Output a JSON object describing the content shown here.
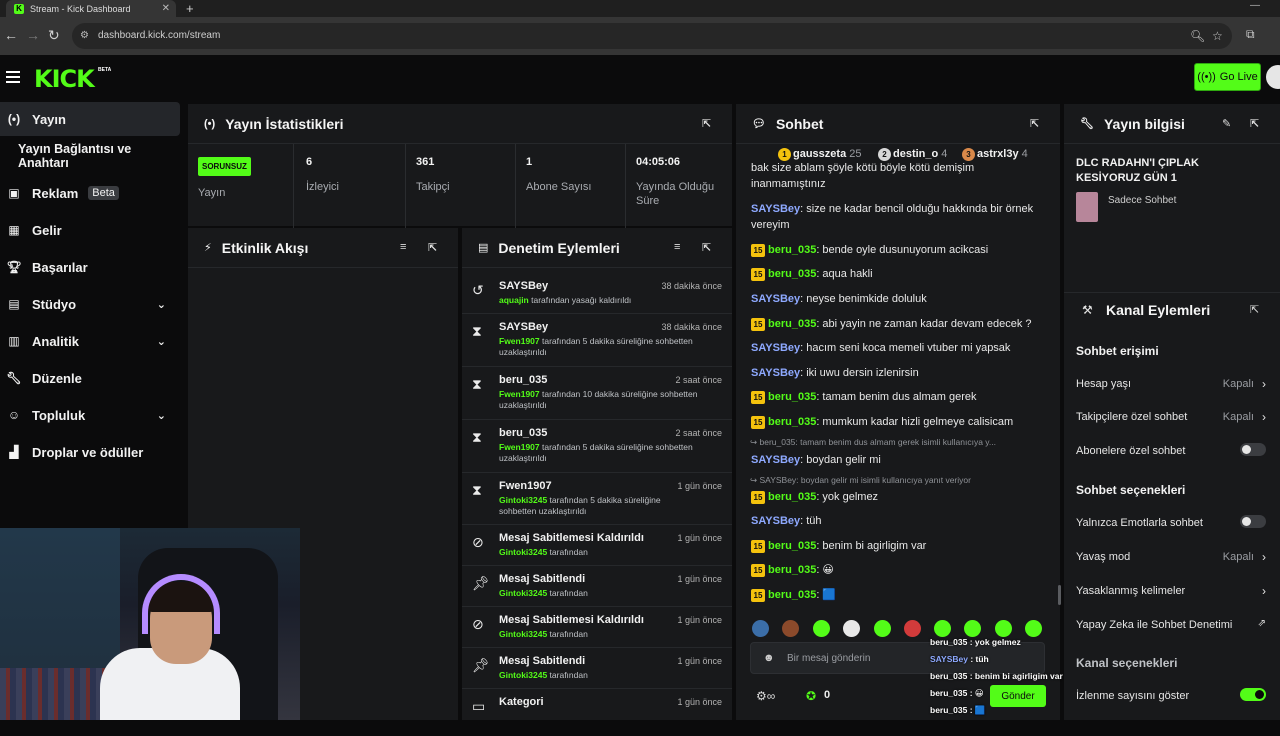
{
  "browser": {
    "tab_title": "Stream - Kick Dashboard",
    "tab_close": "✕",
    "new_tab": "+",
    "url": "dashboard.kick.com/stream"
  },
  "header": {
    "logo": "KICK",
    "logo_badge": "BETA",
    "go_live": "Go Live"
  },
  "sidebar": {
    "items": [
      {
        "label": "Yayın",
        "icon": "broadcast-icon"
      },
      {
        "label": "Yayın Bağlantısı ve Anahtarı",
        "icon": ""
      },
      {
        "label": "Reklam",
        "icon": "ad-icon",
        "badge": "Beta"
      },
      {
        "label": "Gelir",
        "icon": "revenue-icon"
      },
      {
        "label": "Başarılar",
        "icon": "trophy-icon"
      },
      {
        "label": "Stüdyo",
        "icon": "studio-icon"
      },
      {
        "label": "Analitik",
        "icon": "analytics-icon"
      },
      {
        "label": "Düzenle",
        "icon": "wrench-icon"
      },
      {
        "label": "Topluluk",
        "icon": "community-icon"
      },
      {
        "label": "Droplar ve ödüller",
        "icon": "drops-icon"
      }
    ]
  },
  "stats": {
    "title": "Yayın İstatistikleri",
    "status_badge": "SORUNSUZ",
    "status_label": "Yayın",
    "items": [
      {
        "value": "6",
        "label": "İzleyici"
      },
      {
        "value": "361",
        "label": "Takipçi"
      },
      {
        "value": "1",
        "label": "Abone Sayısı"
      },
      {
        "value": "04:05:06",
        "label": "Yayında Olduğu Süre"
      }
    ]
  },
  "activity": {
    "title": "Etkinlik Akışı"
  },
  "moderation": {
    "title": "Denetim Eylemleri",
    "rows": [
      {
        "icon": "undo-icon",
        "title": "SAYSBey",
        "time": "38 dakika önce",
        "user": "aquajin",
        "text": " tarafından yasağı kaldırıldı"
      },
      {
        "icon": "hourglass-icon",
        "title": "SAYSBey",
        "time": "38 dakika önce",
        "user": "Fwen1907",
        "text": " tarafından 5 dakika süreliğine sohbetten uzaklaştırıldı"
      },
      {
        "icon": "hourglass-icon",
        "title": "beru_035",
        "time": "2 saat önce",
        "user": "Fwen1907",
        "text": " tarafından 10 dakika süreliğine sohbetten uzaklaştırıldı"
      },
      {
        "icon": "hourglass-icon",
        "title": "beru_035",
        "time": "2 saat önce",
        "user": "Fwen1907",
        "text": " tarafından 5 dakika süreliğine sohbetten uzaklaştırıldı"
      },
      {
        "icon": "hourglass-icon",
        "title": "Fwen1907",
        "time": "1 gün önce",
        "user": "Gintoki3245",
        "text": " tarafından 5 dakika süreliğine sohbetten uzaklaştırıldı"
      },
      {
        "icon": "unpin-icon",
        "title": "Mesaj Sabitlemesi Kaldırıldı",
        "time": "1 gün önce",
        "user": "Gintoki3245",
        "text": " tarafından"
      },
      {
        "icon": "pin-icon",
        "title": "Mesaj Sabitlendi",
        "time": "1 gün önce",
        "user": "Gintoki3245",
        "text": " tarafından"
      },
      {
        "icon": "unpin-icon",
        "title": "Mesaj Sabitlemesi Kaldırıldı",
        "time": "1 gün önce",
        "user": "Gintoki3245",
        "text": " tarafından"
      },
      {
        "icon": "pin-icon",
        "title": "Mesaj Sabitlendi",
        "time": "1 gün önce",
        "user": "Gintoki3245",
        "text": " tarafından"
      },
      {
        "icon": "category-icon",
        "title": "Kategori",
        "time": "1 gün önce",
        "user": "",
        "text": ""
      }
    ]
  },
  "chat": {
    "title": "Sohbet",
    "leaders": [
      {
        "rank": "1",
        "name": "gausszeta",
        "count": "25",
        "color": "#f4c20d"
      },
      {
        "rank": "2",
        "name": "destin_o",
        "count": "4",
        "color": "#d7d7d7"
      },
      {
        "rank": "3",
        "name": "astrxl3y",
        "count": "4",
        "color": "#d9894a"
      }
    ],
    "messages": [
      {
        "badge": false,
        "user": "",
        "ucolor": "b",
        "text": "bak size ablam şöyle kötü böyle kötü demişim inanmamıştınız",
        "partial": true
      },
      {
        "badge": false,
        "user": "SAYSBey",
        "ucolor": "b",
        "text": ": size ne kadar bencil olduğu hakkında bir örnek vereyim"
      },
      {
        "badge": true,
        "user": "beru_035",
        "ucolor": "g",
        "text": ": bende oyle dusunuyorum acikcasi"
      },
      {
        "badge": true,
        "user": "beru_035",
        "ucolor": "g",
        "text": ": aqua hakli"
      },
      {
        "badge": false,
        "user": "SAYSBey",
        "ucolor": "b",
        "text": ": neyse benimkide doluluk"
      },
      {
        "badge": true,
        "user": "beru_035",
        "ucolor": "g",
        "text": ": abi yayin ne zaman kadar devam edecek ?"
      },
      {
        "badge": false,
        "user": "SAYSBey",
        "ucolor": "b",
        "text": ": hacım seni koca memeli vtuber mi yapsak"
      },
      {
        "badge": false,
        "user": "SAYSBey",
        "ucolor": "b",
        "text": ": iki uwu dersin izlenirsin"
      },
      {
        "badge": true,
        "user": "beru_035",
        "ucolor": "g",
        "text": ": tamam benim dus almam gerek"
      },
      {
        "badge": true,
        "user": "beru_035",
        "ucolor": "g",
        "text": ": mumkum kadar hizli gelmeye calisicam"
      },
      {
        "reply": "↪ beru_035: tamam benim dus almam gerek isimli kullanıcıya y..."
      },
      {
        "badge": false,
        "user": "SAYSBey",
        "ucolor": "b",
        "text": ": boydan gelir mi"
      },
      {
        "reply": "↪ SAYSBey: boydan gelir mi isimli kullanıcıya yanıt veriyor"
      },
      {
        "badge": true,
        "user": "beru_035",
        "ucolor": "g",
        "text": ": yok gelmez"
      },
      {
        "badge": false,
        "user": "SAYSBey",
        "ucolor": "b",
        "text": ": tüh"
      },
      {
        "badge": true,
        "user": "beru_035",
        "ucolor": "g",
        "text": ": benim bi agirligim var"
      },
      {
        "badge": true,
        "user": "beru_035",
        "ucolor": "g",
        "text": ": 😀"
      },
      {
        "badge": true,
        "user": "beru_035",
        "ucolor": "g",
        "text": ": 🟦"
      }
    ],
    "input_placeholder": "Bir mesaj gönderin",
    "send": "Gönder",
    "points": "0",
    "badge_text": "15"
  },
  "overlay": [
    {
      "user": "beru_035",
      "text": " : yok gelmez",
      "c": "og"
    },
    {
      "user": "SAYSBey",
      "text": " : tüh",
      "c": "ob"
    },
    {
      "user": "beru_035",
      "text": " : benim bi agirligim var",
      "c": "og"
    },
    {
      "user": "beru_035",
      "text": " : 😀",
      "c": "og"
    },
    {
      "user": "beru_035",
      "text": " : 🟦",
      "c": "og"
    }
  ],
  "info": {
    "title": "Yayın bilgisi",
    "stream_title": "DLC RADAHN'I ÇIPLAK KESİYORUZ GÜN 1",
    "mode_tag": "Sadece Sohbet",
    "actions_title": "Kanal Eylemleri",
    "chat_access": "Sohbet erişimi",
    "account_age": "Hesap yaşı",
    "account_age_val": "Kapalı",
    "followers_only": "Takipçilere özel sohbet",
    "followers_only_val": "Kapalı",
    "subs_only": "Abonelere özel sohbet",
    "chat_options": "Sohbet seçenekleri",
    "emote_only": "Yalnızca Emotlarla sohbet",
    "slow_mode": "Yavaş mod",
    "slow_mode_val": "Kapalı",
    "banned_words": "Yasaklanmış kelimeler",
    "ai_mod": "Yapay Zeka ile Sohbet Denetimi",
    "channel_options": "Kanal seçenekleri",
    "show_viewcount": "İzlenme sayısını göster"
  }
}
